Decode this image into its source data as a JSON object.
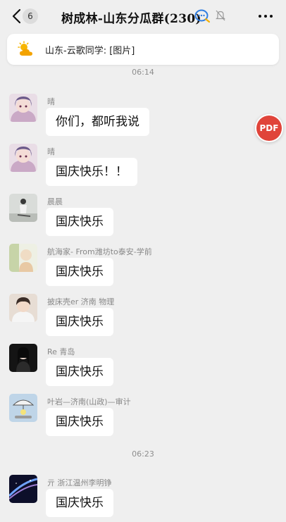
{
  "header": {
    "back_badge": "6",
    "title": "树成林-山东分瓜群(230)"
  },
  "notice": {
    "text": "山东-云歌同学: [图片]"
  },
  "cut_time": "06:14",
  "pdf_label": "PDF",
  "messages": [
    {
      "sender": "晴",
      "text": "你们，都听我说"
    },
    {
      "sender": "晴",
      "text": "国庆快乐！！"
    },
    {
      "sender": "晨晨",
      "text": "国庆快乐"
    },
    {
      "sender": "航海家- From潍坊to泰安-学前",
      "text": "国庆快乐"
    },
    {
      "sender": "披床壳er 济南 物理",
      "text": "国庆快乐"
    },
    {
      "sender": "Re 青岛",
      "text": "国庆快乐"
    },
    {
      "sender": "叶岩—济南(山政)—审计",
      "text": "国庆快乐"
    },
    {
      "sender": "亓 浙江温州李明铮",
      "text": "国庆快乐"
    }
  ],
  "time_divider": "06:23",
  "colors": {
    "background": "#efefef",
    "bubble": "#ffffff",
    "pdf_red": "#e0443a",
    "sender_gray": "#888888"
  }
}
